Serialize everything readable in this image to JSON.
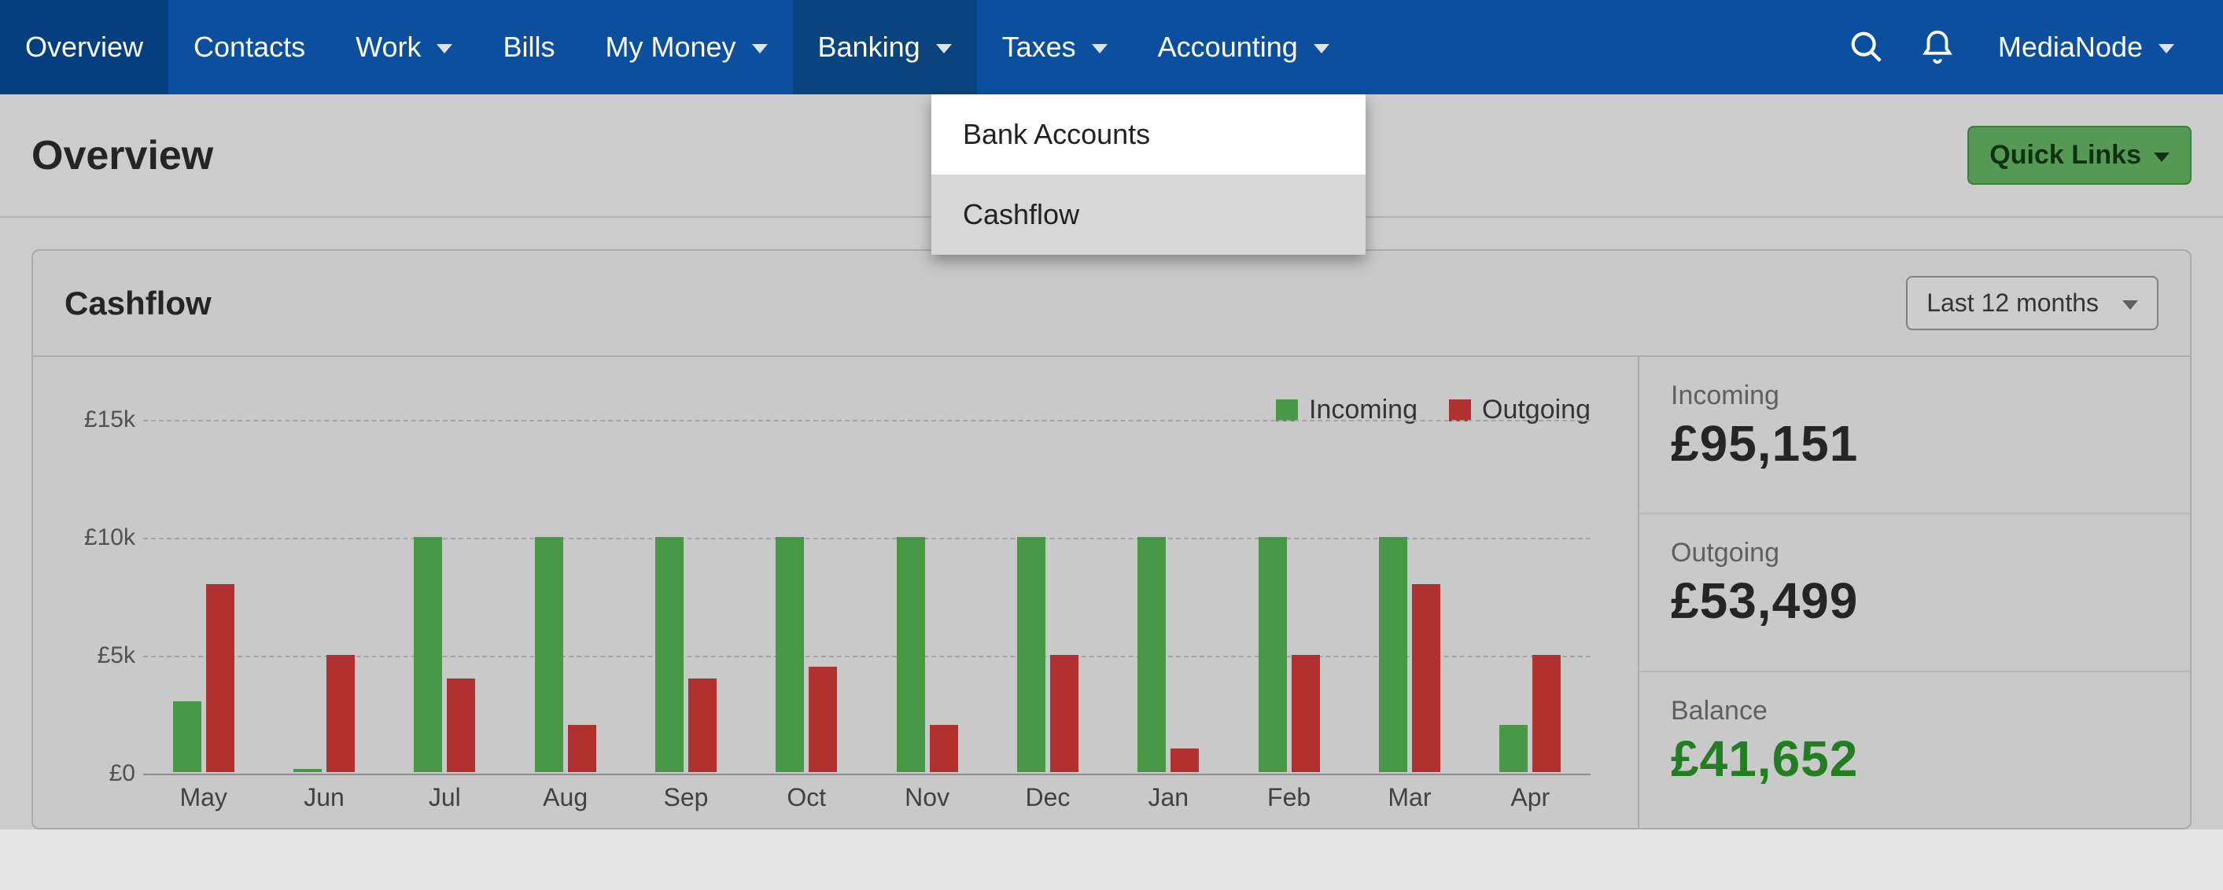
{
  "nav": {
    "items": [
      {
        "label": "Overview",
        "hasChevron": false,
        "state": "active"
      },
      {
        "label": "Contacts",
        "hasChevron": false,
        "state": ""
      },
      {
        "label": "Work",
        "hasChevron": true,
        "state": ""
      },
      {
        "label": "Bills",
        "hasChevron": false,
        "state": ""
      },
      {
        "label": "My Money",
        "hasChevron": true,
        "state": ""
      },
      {
        "label": "Banking",
        "hasChevron": true,
        "state": "open"
      },
      {
        "label": "Taxes",
        "hasChevron": true,
        "state": ""
      },
      {
        "label": "Accounting",
        "hasChevron": true,
        "state": ""
      }
    ],
    "company": "MediaNode"
  },
  "dropdown": {
    "items": [
      {
        "label": "Bank Accounts",
        "hover": true
      },
      {
        "label": "Cashflow",
        "hover": false
      }
    ]
  },
  "page": {
    "title": "Overview",
    "quick_links": "Quick Links"
  },
  "cashflow_card": {
    "title": "Cashflow",
    "period": "Last 12 months",
    "legend": {
      "incoming": "Incoming",
      "outgoing": "Outgoing"
    },
    "summary": {
      "incoming_label": "Incoming",
      "incoming_value": "£95,151",
      "outgoing_label": "Outgoing",
      "outgoing_value": "£53,499",
      "balance_label": "Balance",
      "balance_value": "£41,652"
    }
  },
  "chart_data": {
    "type": "bar",
    "title": "Cashflow",
    "xlabel": "",
    "ylabel": "",
    "ylim": [
      0,
      16000
    ],
    "y_ticks": [
      "£0",
      "£5k",
      "£10k",
      "£15k"
    ],
    "categories": [
      "May",
      "Jun",
      "Jul",
      "Aug",
      "Sep",
      "Oct",
      "Nov",
      "Dec",
      "Jan",
      "Feb",
      "Mar",
      "Apr"
    ],
    "series": [
      {
        "name": "Incoming",
        "color": "#4aa94a",
        "values": [
          3000,
          150,
          10000,
          10000,
          10000,
          10000,
          10000,
          10000,
          10000,
          10000,
          10000,
          2000
        ]
      },
      {
        "name": "Outgoing",
        "color": "#c62f2f",
        "values": [
          8000,
          5000,
          4000,
          2000,
          4000,
          4500,
          2000,
          5000,
          1000,
          5000,
          8000,
          5000
        ]
      }
    ],
    "legend_position": "top-right",
    "grid": true
  }
}
